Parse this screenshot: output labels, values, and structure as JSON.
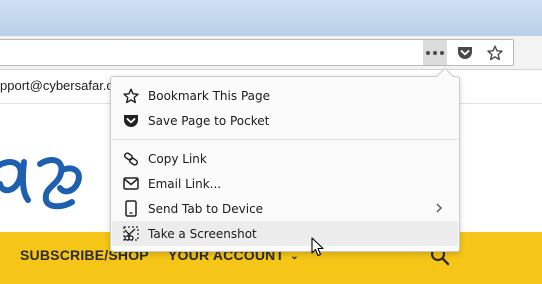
{
  "browser": {
    "page_actions": {
      "more_icon": "dots-icon",
      "pocket_icon": "pocket-icon",
      "bookmark_icon": "star-icon"
    }
  },
  "page": {
    "email_partial": "pport@cybersafar.c",
    "logo_text": "ફર",
    "nav": {
      "subscribe": "SUBSCRIBE/SHOP",
      "account": "YOUR ACCOUNT",
      "account_caret": "⌄"
    },
    "accent_color": "#f5c518",
    "logo_color": "#1f5fb0"
  },
  "menu": {
    "items": [
      {
        "label": "Bookmark This Page",
        "icon": "star-icon"
      },
      {
        "label": "Save Page to Pocket",
        "icon": "pocket-icon"
      },
      {
        "label": "Copy Link",
        "icon": "link-icon"
      },
      {
        "label": "Email Link...",
        "icon": "envelope-icon"
      },
      {
        "label": "Send Tab to Device",
        "icon": "device-icon",
        "has_submenu": true
      },
      {
        "label": "Take a Screenshot",
        "icon": "scissors-icon",
        "hovered": true
      }
    ]
  }
}
